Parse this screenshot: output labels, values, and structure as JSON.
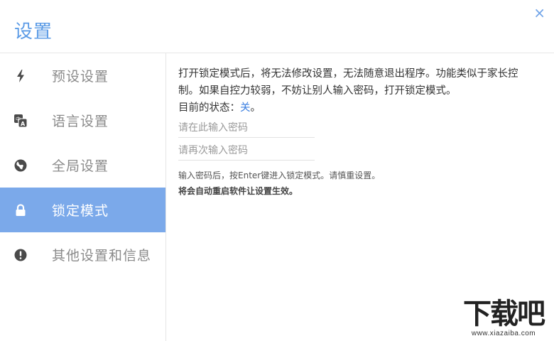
{
  "window": {
    "title": "设置",
    "close_glyph": "×"
  },
  "sidebar": {
    "items": [
      {
        "label": "预设设置",
        "icon": "lightning-icon"
      },
      {
        "label": "语言设置",
        "icon": "translate-icon"
      },
      {
        "label": "全局设置",
        "icon": "globe-icon"
      },
      {
        "label": "锁定模式",
        "icon": "lock-icon",
        "active": true
      },
      {
        "label": "其他设置和信息",
        "icon": "info-icon"
      }
    ]
  },
  "lock_mode": {
    "description": "打开锁定模式后，将无法修改设置，无法随意退出程序。功能类似于家长控制。如果自控力较弱，不妨让别人输入密码，打开锁定模式。",
    "status_prefix": "目前的状态：",
    "status_value": "关",
    "status_suffix": "。",
    "password_placeholder": "请在此输入密码",
    "confirm_placeholder": "请再次输入密码",
    "hint": "输入密码后，按Enter键进入锁定模式。请慎重设置。",
    "warning": "将会自动重启软件让设置生效。"
  },
  "watermark": {
    "main": "下载吧",
    "sub": "www.xiazaiba.com"
  },
  "colors": {
    "accent": "#5b9be6",
    "active_item_bg": "#7ba9ea",
    "status_value": "#3b7fe0",
    "icon_gray": "#4a4a4a"
  }
}
